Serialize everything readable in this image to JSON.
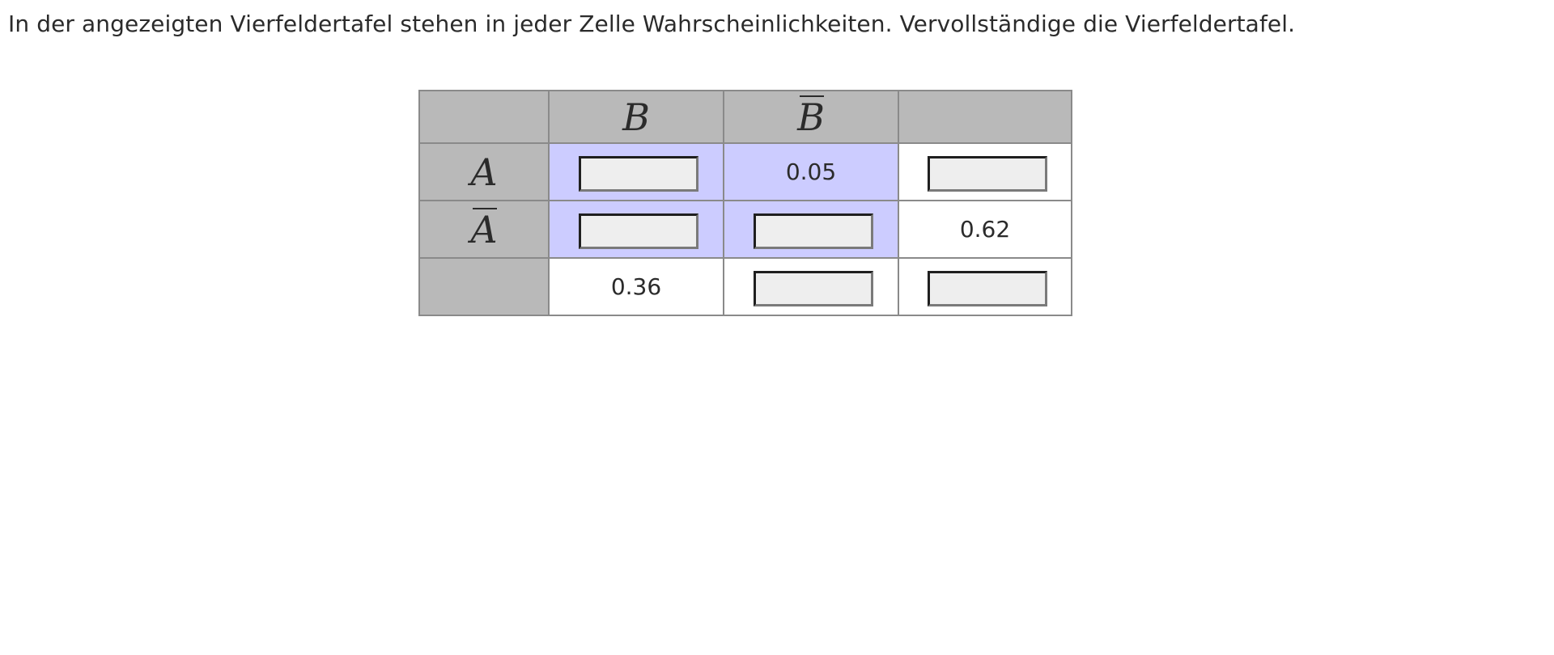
{
  "instruction": "In der angezeigten Vierfeldertafel stehen in jeder Zelle Wahrscheinlichkeiten. Vervollständige die Vierfeldertafel.",
  "table": {
    "col_headers": {
      "b": "B",
      "b_bar": "B",
      "total": ""
    },
    "row_headers": {
      "a": "A",
      "a_bar": "A",
      "total": ""
    },
    "cells": {
      "a_b": {
        "given": "",
        "input_value": ""
      },
      "a_bbar": {
        "given": "0.05"
      },
      "a_total": {
        "given": "",
        "input_value": ""
      },
      "abar_b": {
        "given": "",
        "input_value": ""
      },
      "abar_bbar": {
        "given": "",
        "input_value": ""
      },
      "abar_total": {
        "given": "0.62"
      },
      "total_b": {
        "given": "0.36"
      },
      "total_bbar": {
        "given": "",
        "input_value": ""
      },
      "total_total": {
        "given": "",
        "input_value": ""
      }
    },
    "colors": {
      "header_bg": "#b9b9b9",
      "highlight_bg": "#ccccff",
      "input_bg": "#eeeeee",
      "border": "#8a8a8a"
    }
  }
}
